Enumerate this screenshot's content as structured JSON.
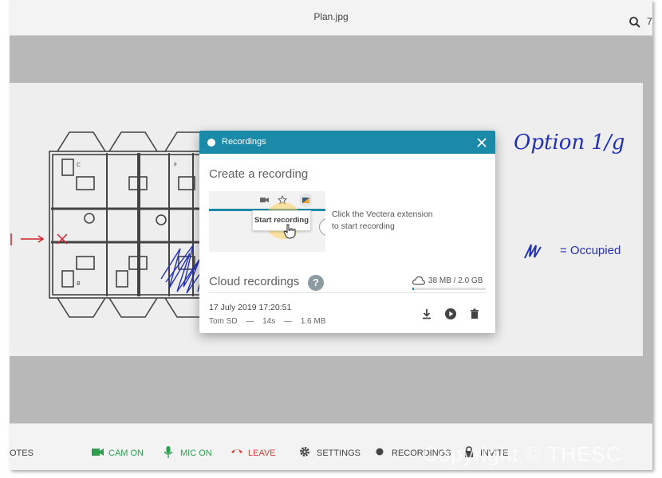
{
  "header": {
    "title": "Plan.jpg",
    "right_text": "7"
  },
  "annotations": {
    "option": "Option 1/g",
    "occupied": "= Occupied"
  },
  "modal": {
    "title": "Recordings",
    "create_title": "Create a recording",
    "demo_tooltip": "Start recording",
    "demo_help": "?",
    "hint_line1": "Click the Vectera extension",
    "hint_line2": "to start recording",
    "cloud_title": "Cloud recordings",
    "help": "?",
    "storage": {
      "used": "38 MB / 2.0 GB",
      "fraction": 0.02
    },
    "recording": {
      "date": "17 July 2019 17:20:51",
      "user": "Tom SD",
      "sep1": "—",
      "duration": "14s",
      "sep2": "—",
      "size": "1.6 MB"
    }
  },
  "toolbar": {
    "notes": "OTES",
    "cam": "CAM ON",
    "mic": "MIC ON",
    "leave": "LEAVE",
    "settings": "SETTINGS",
    "recordings": "RECORDINGS",
    "invite": "INVITE"
  },
  "colors": {
    "accent": "#1a8aa8",
    "cam": "#2e9e4f",
    "leave": "#d0453b",
    "ink": "#2330b8"
  },
  "watermark": "Copyright © THESC"
}
